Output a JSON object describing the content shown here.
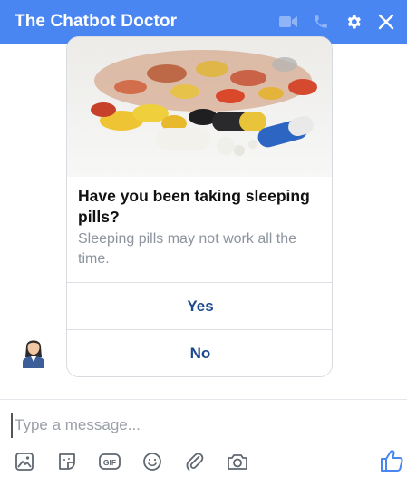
{
  "header": {
    "title": "The Chatbot Doctor",
    "bg_color": "#4a86f2",
    "icons": [
      "video-camera-icon",
      "phone-icon",
      "gear-icon",
      "close-icon"
    ]
  },
  "card": {
    "image": "pills-photo",
    "title": "Have you been taking sleeping pills?",
    "subtitle": "Sleeping pills may not work all the time.",
    "buttons": [
      {
        "label": "Yes"
      },
      {
        "label": "No"
      }
    ],
    "button_color": "#1d4a8f"
  },
  "composer": {
    "placeholder": "Type a message..."
  },
  "toolbar": {
    "icons": [
      "image-icon",
      "sticker-icon",
      "gif-icon",
      "emoji-icon",
      "attachment-icon",
      "camera-icon"
    ],
    "gif_label": "GIF",
    "like_icon": "thumbs-up-icon",
    "accent": "#4a86f2"
  }
}
